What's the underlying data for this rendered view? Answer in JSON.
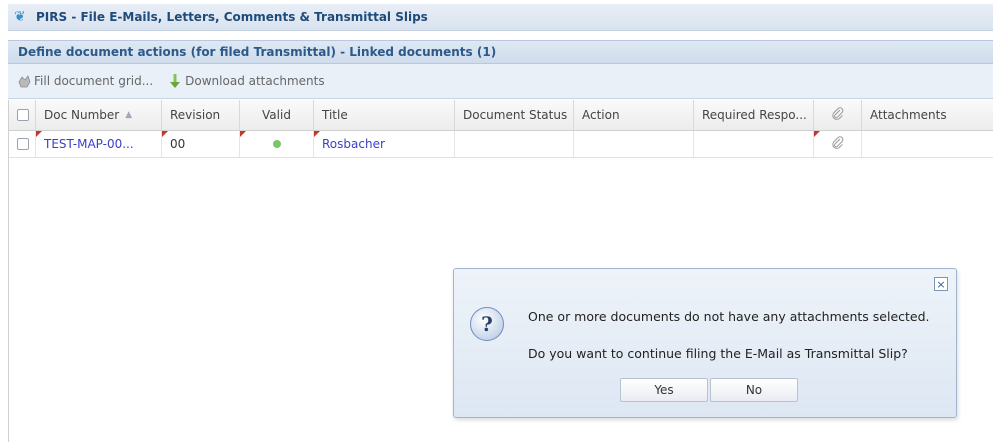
{
  "window": {
    "title": "PIRS - File E-Mails, Letters, Comments & Transmittal Slips"
  },
  "panel": {
    "title": "Define document actions (for filed Transmittal) - Linked documents (1)"
  },
  "toolbar": {
    "fill_grid_label": "Fill document grid...",
    "download_label": "Download attachments"
  },
  "grid": {
    "columns": {
      "doc_number": "Doc Number",
      "revision": "Revision",
      "valid": "Valid",
      "title": "Title",
      "document_status": "Document Status",
      "action": "Action",
      "required_response": "Required Respo...",
      "attachments": "Attachments"
    },
    "rows": [
      {
        "doc_number": "TEST-MAP-00...",
        "revision": "00",
        "valid": true,
        "title": "Rosbacher",
        "document_status": "",
        "action": "",
        "required_response": "",
        "attachments": ""
      }
    ]
  },
  "dialog": {
    "message_line1": "One or more documents do not have any attachments selected.",
    "message_line2": "Do you want to continue filing the E-Mail as Transmittal Slip?",
    "yes_label": "Yes",
    "no_label": "No",
    "close_label": "×"
  },
  "colors": {
    "link": "#3b3fc6",
    "valid_dot": "#7ec46b",
    "dirty_flag": "#c0392b"
  }
}
